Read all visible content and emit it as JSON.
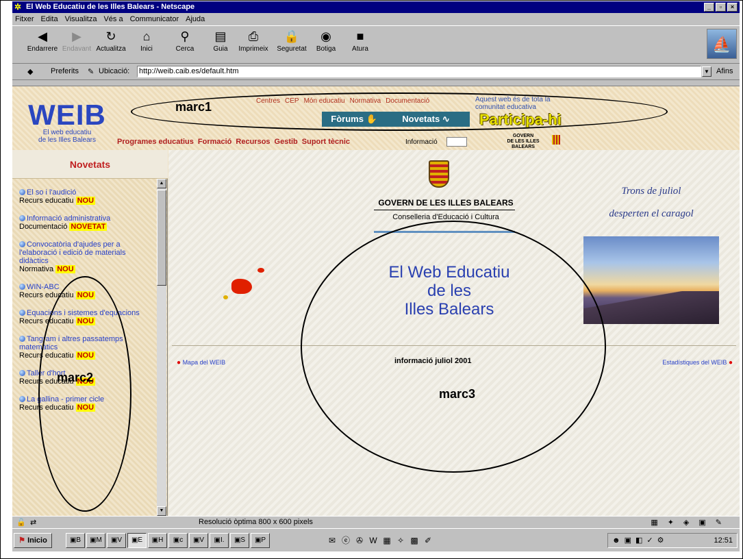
{
  "window": {
    "title": "El Web Educatiu de les Illes Balears - Netscape",
    "buttons": [
      "_",
      "▫",
      "×"
    ]
  },
  "menu": [
    "Fitxer",
    "Edita",
    "Visualitza",
    "Vés a",
    "Communicator",
    "Ajuda"
  ],
  "toolbar": [
    {
      "label": "Endarrere",
      "icon": "back-arrow-icon",
      "glyph": "◀",
      "disabled": false
    },
    {
      "label": "Endavant",
      "icon": "forward-arrow-icon",
      "glyph": "▶",
      "disabled": true
    },
    {
      "label": "Actualitza",
      "icon": "reload-icon",
      "glyph": "↻",
      "disabled": false
    },
    {
      "label": "Inici",
      "icon": "home-icon",
      "glyph": "⌂",
      "disabled": false
    },
    {
      "label": "Cerca",
      "icon": "search-icon",
      "glyph": "⚲",
      "disabled": false
    },
    {
      "label": "Guia",
      "icon": "guide-icon",
      "glyph": "▤",
      "disabled": false
    },
    {
      "label": "Imprimeix",
      "icon": "print-icon",
      "glyph": "⎙",
      "disabled": false
    },
    {
      "label": "Seguretat",
      "icon": "lock-icon",
      "glyph": "🔒",
      "disabled": false
    },
    {
      "label": "Botiga",
      "icon": "shop-icon",
      "glyph": "◉",
      "disabled": false
    },
    {
      "label": "Atura",
      "icon": "stop-icon",
      "glyph": "■",
      "disabled": false
    }
  ],
  "location": {
    "bookmarks": "Preferits",
    "label": "Ubicació:",
    "url": "http://weib.caib.es/default.htm",
    "related": "Afins"
  },
  "header": {
    "logo_text": "WEIB",
    "logo_sub1": "El web educatiu",
    "logo_sub2": "de les Illes Balears",
    "topnav": [
      "Centres",
      "CEP",
      "Món educatiu",
      "Normativa",
      "Documentació"
    ],
    "webnote": "Aquest web és de tota la comunitat educativa",
    "forums": "Fòrums",
    "novetats": "Novetats",
    "participa": "Participa-hi",
    "programs": [
      "Programes educatius",
      "Formació",
      "Recursos",
      "Gestib",
      "Suport tècnic"
    ],
    "info": "Informació",
    "govern1": "GOVERN",
    "govern2": "DE LES ILLES BALEARS",
    "marc1": "marc1"
  },
  "sidebar": {
    "title": "Novetats",
    "marc2": "marc2",
    "items": [
      {
        "title": "El so i l'audició",
        "type": "Recurs educatiu",
        "badge": "NOU"
      },
      {
        "title": "Informació administrativa",
        "type": "Documentació",
        "badge": "NOVETAT"
      },
      {
        "title": "Convocatòria d'ajudes per a l'elaboració i edició de materials didàctics",
        "type": "Normativa",
        "badge": "NOU"
      },
      {
        "title": "WIN-ABC",
        "type": "Recurs educatiu",
        "badge": "NOU"
      },
      {
        "title": "Equacions i sistemes d'equacions",
        "type": "Recurs educatiu",
        "badge": "NOU"
      },
      {
        "title": "Tangram i altres passatemps matemàtics",
        "type": "Recurs educatiu",
        "badge": "NOU"
      },
      {
        "title": "Taller d'hort",
        "type": "Recurs educatiu",
        "badge": "NOU"
      },
      {
        "title": "La gallina - primer cicle",
        "type": "Recurs educatiu",
        "badge": "NOU"
      }
    ]
  },
  "main": {
    "gov_title": "GOVERN DE LES ILLES BALEARS",
    "conselleria": "Conselleria d'Educació i Cultura",
    "heading1": "El Web Educatiu",
    "heading2": "de les",
    "heading3": "Illes Balears",
    "poem1": "Trons de juliol",
    "poem2": "desperten el caragol",
    "map_link": "Mapa del WEIB",
    "info_month": "informació juliol 2001",
    "stats_link": "Estadístiques del WEIB",
    "marc3": "marc3"
  },
  "status": {
    "text": "Resolució òptima  800 x 600 pixels"
  },
  "taskbar": {
    "start": "Inicio",
    "tasks": [
      "B",
      "M",
      "V",
      "E",
      "H",
      "c",
      "V",
      "I.",
      "S",
      "P"
    ],
    "clock": "12:51"
  }
}
